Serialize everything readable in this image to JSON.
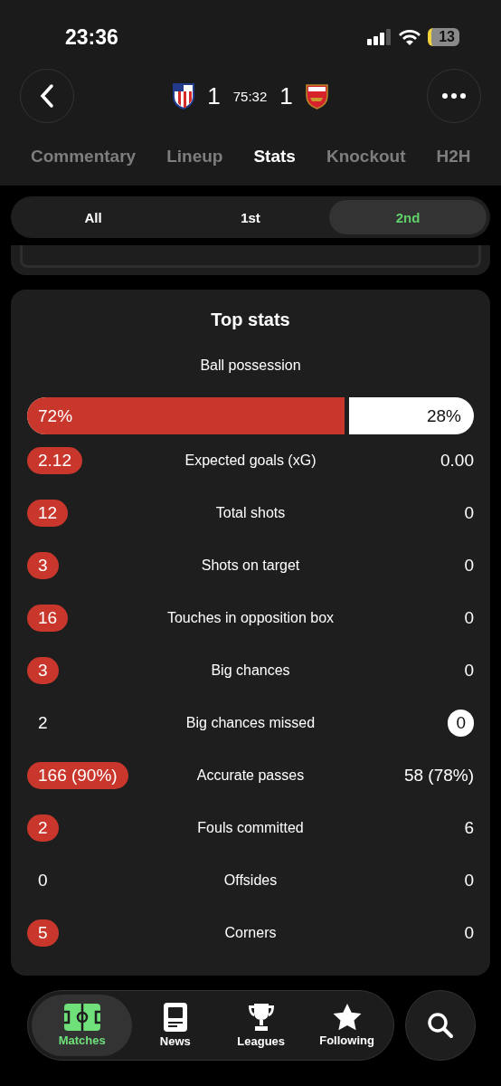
{
  "status_bar": {
    "time": "23:36",
    "battery": "13"
  },
  "match": {
    "home_score": "1",
    "clock": "75:32",
    "away_score": "1"
  },
  "tabs": [
    {
      "label": "Commentary",
      "selected": false
    },
    {
      "label": "Lineup",
      "selected": false
    },
    {
      "label": "Stats",
      "selected": true
    },
    {
      "label": "Knockout",
      "selected": false
    },
    {
      "label": "H2H",
      "selected": false
    }
  ],
  "periods": [
    {
      "label": "All",
      "selected": false
    },
    {
      "label": "1st",
      "selected": false
    },
    {
      "label": "2nd",
      "selected": true
    }
  ],
  "top_stats": {
    "title": "Top stats",
    "possession": {
      "label": "Ball possession",
      "home": "72%",
      "away": "28%",
      "level": 0.72
    },
    "rows": [
      {
        "home": "2.12",
        "label": "Expected goals (xG)",
        "away": "0.00",
        "home_highlighted": true,
        "away_highlighted": false
      },
      {
        "home": "12",
        "label": "Total shots",
        "away": "0",
        "home_highlighted": true,
        "away_highlighted": false
      },
      {
        "home": "3",
        "label": "Shots on target",
        "away": "0",
        "home_highlighted": true,
        "away_highlighted": false
      },
      {
        "home": "16",
        "label": "Touches in opposition box",
        "away": "0",
        "home_highlighted": true,
        "away_highlighted": false
      },
      {
        "home": "3",
        "label": "Big chances",
        "away": "0",
        "home_highlighted": true,
        "away_highlighted": false
      },
      {
        "home": "2",
        "label": "Big chances missed",
        "away": "0",
        "home_highlighted": false,
        "away_highlighted": true
      },
      {
        "home": "166 (90%)",
        "label": "Accurate passes",
        "away": "58 (78%)",
        "home_highlighted": true,
        "away_highlighted": false
      },
      {
        "home": "2",
        "label": "Fouls committed",
        "away": "6",
        "home_highlighted": true,
        "away_highlighted": false
      },
      {
        "home": "0",
        "label": "Offsides",
        "away": "0",
        "home_highlighted": false,
        "away_highlighted": false
      },
      {
        "home": "5",
        "label": "Corners",
        "away": "0",
        "home_highlighted": true,
        "away_highlighted": false
      }
    ]
  },
  "nav": [
    {
      "label": "Matches",
      "kind": "pitch",
      "selected": true
    },
    {
      "label": "News",
      "kind": "news",
      "selected": false
    },
    {
      "label": "Leagues",
      "kind": "trophy",
      "selected": false
    },
    {
      "label": "Following",
      "kind": "star",
      "selected": false
    }
  ]
}
